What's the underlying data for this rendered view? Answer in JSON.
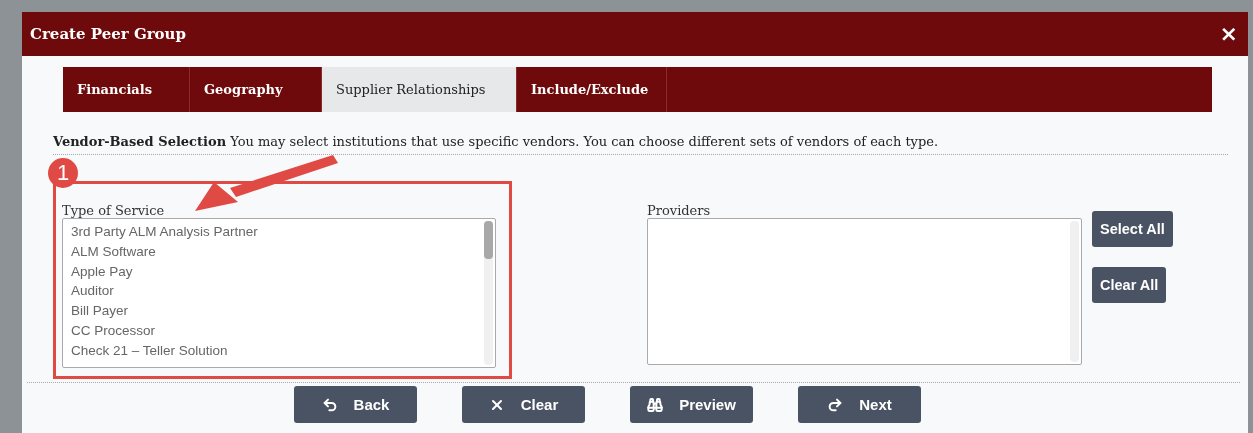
{
  "dialog": {
    "title": "Create Peer Group",
    "close": "×"
  },
  "tabs": [
    {
      "label": "Financials",
      "selected": false
    },
    {
      "label": "Geography",
      "selected": false
    },
    {
      "label": "Supplier Relationships",
      "selected": true
    },
    {
      "label": "Include/Exclude",
      "selected": false
    }
  ],
  "intro": "**Vendor-Based Selection** You may select institutions that use specific vendors. You can choose different sets of vendors of each type.",
  "annotation": {
    "number": "1"
  },
  "type_of_service": {
    "label": "Type of Service",
    "items": [
      "3rd Party ALM Analysis Partner",
      "ALM Software",
      "Apple Pay",
      "Auditor",
      "Bill Payer",
      "CC Processor",
      "Check 21 – Teller Solution"
    ]
  },
  "providers": {
    "label": "Providers",
    "buttons": [
      "Select All",
      "Clear All"
    ]
  },
  "footer_buttons": [
    {
      "kind": "back",
      "label": "Back"
    },
    {
      "kind": "clear",
      "label": "Clear"
    },
    {
      "kind": "preview",
      "label": "Preview"
    },
    {
      "kind": "next",
      "label": "Next"
    }
  ]
}
